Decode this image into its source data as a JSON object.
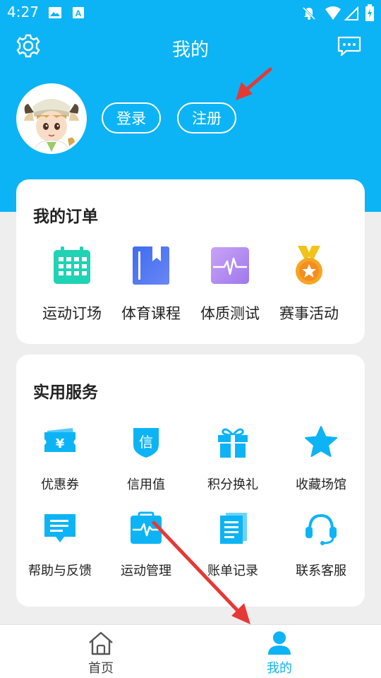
{
  "status_bar": {
    "time": "4:27",
    "icons": [
      "image-icon",
      "a-icon",
      "bell-off-icon",
      "wifi-icon",
      "signal-icon",
      "battery-charging-icon"
    ]
  },
  "header": {
    "title": "我的",
    "settings_icon": "gear-icon",
    "message_icon": "message-icon"
  },
  "profile": {
    "login_label": "登录",
    "register_label": "注册"
  },
  "orders": {
    "title": "我的订单",
    "items": [
      {
        "label": "运动订场",
        "icon": "calendar-icon",
        "color": "#1FD3B4"
      },
      {
        "label": "体育课程",
        "icon": "book-icon",
        "color": "#5B7BF3"
      },
      {
        "label": "体质测试",
        "icon": "pulse-icon",
        "color": "#B58CF0"
      },
      {
        "label": "赛事活动",
        "icon": "medal-icon",
        "color": "#F5A623"
      }
    ]
  },
  "services": {
    "title": "实用服务",
    "items": [
      {
        "label": "优惠券",
        "icon": "coupon-icon"
      },
      {
        "label": "信用值",
        "icon": "credit-shield-icon"
      },
      {
        "label": "积分换礼",
        "icon": "gift-icon"
      },
      {
        "label": "收藏场馆",
        "icon": "star-icon"
      },
      {
        "label": "帮助与反馈",
        "icon": "chat-feedback-icon"
      },
      {
        "label": "运动管理",
        "icon": "clipboard-pulse-icon"
      },
      {
        "label": "账单记录",
        "icon": "document-icon"
      },
      {
        "label": "联系客服",
        "icon": "headset-icon"
      }
    ],
    "icon_color": "#0DB4F5"
  },
  "bottom_nav": {
    "items": [
      {
        "label": "首页",
        "icon": "home-icon"
      },
      {
        "label": "我的",
        "icon": "user-icon",
        "active": true
      }
    ]
  },
  "colors": {
    "brand": "#0DB4F5",
    "background": "#EEEEEE",
    "annotation_arrow": "#E53935"
  }
}
